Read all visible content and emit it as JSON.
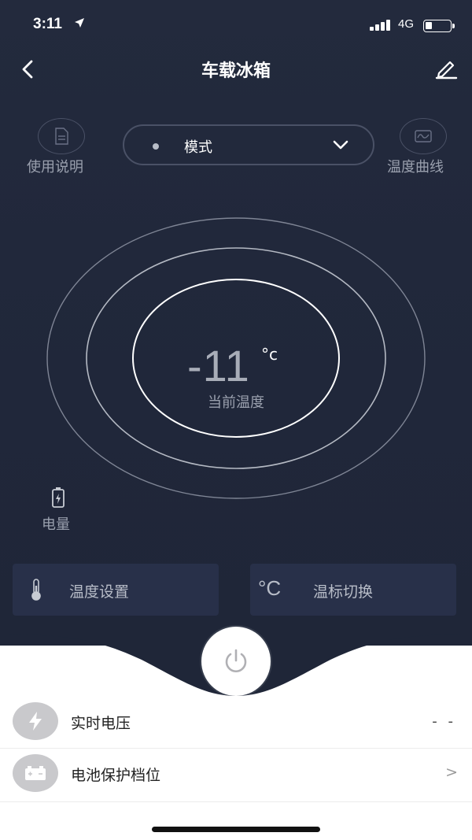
{
  "status_bar": {
    "time": "3:11",
    "network": "4G"
  },
  "nav": {
    "title": "车载冰箱",
    "back_icon": "chevron-left-icon",
    "edit_icon": "pencil-icon"
  },
  "top": {
    "manual_label": "使用说明",
    "mode_label": "模式",
    "curve_label": "温度曲线"
  },
  "temperature": {
    "value": "-11",
    "unit": "°c",
    "label": "当前温度"
  },
  "battery": {
    "label": "电量"
  },
  "cards": {
    "temp_setting": "温度设置",
    "unit_switch": "温标切换",
    "unit_symbol": "°C"
  },
  "list": [
    {
      "label": "实时电压",
      "value": "- -",
      "icon": "lightning-icon"
    },
    {
      "label": "电池保护档位",
      "value": ">",
      "icon": "car-battery-icon"
    }
  ],
  "colors": {
    "dark_bg": "#232a3d",
    "card_bg": "#283049",
    "ring": "#ffffff"
  }
}
